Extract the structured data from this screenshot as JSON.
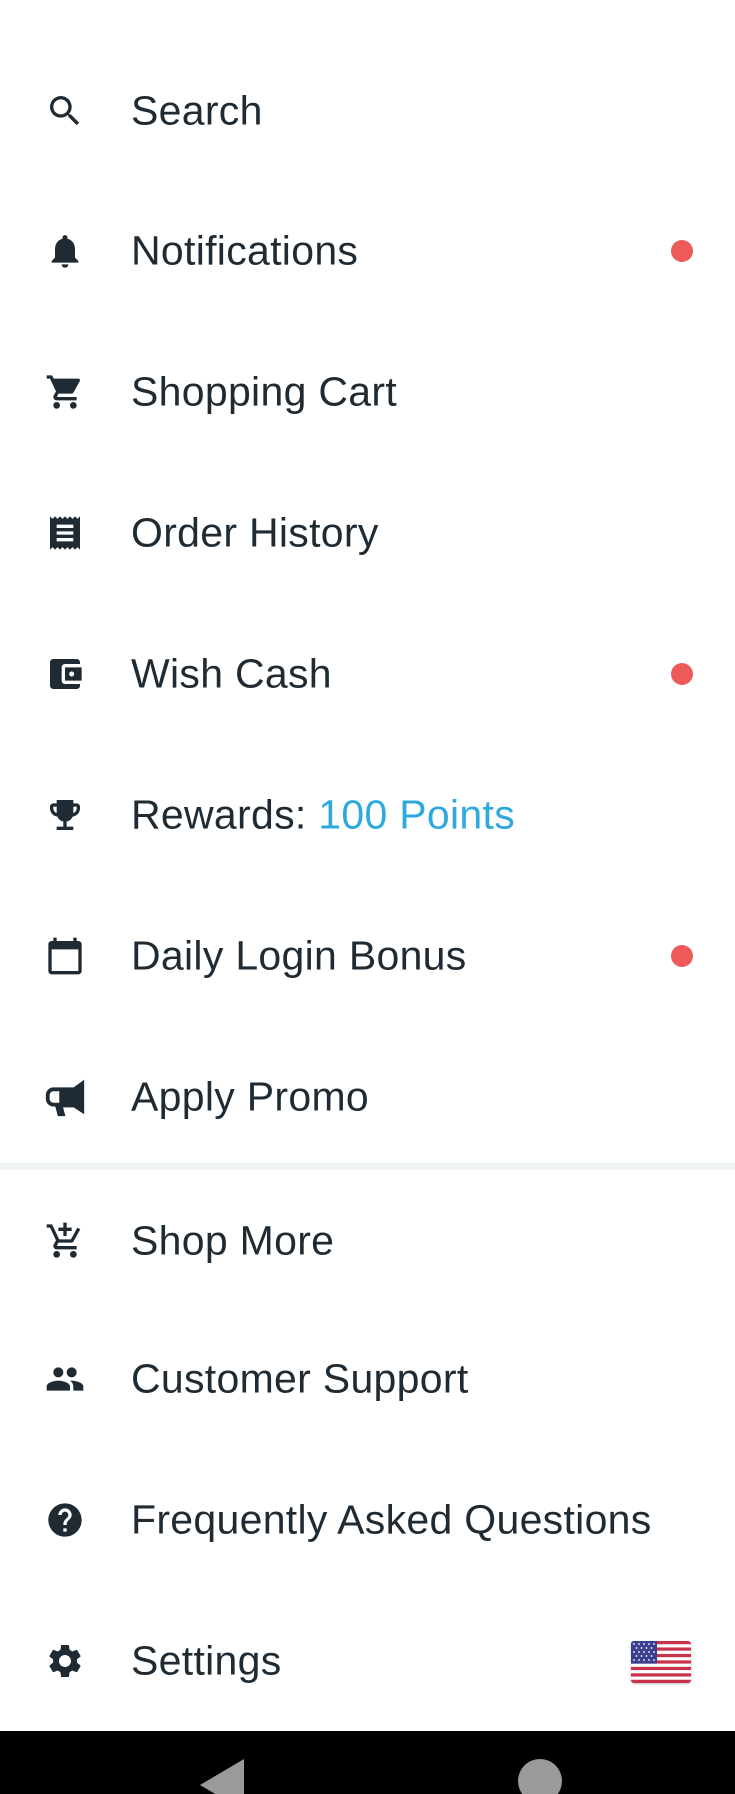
{
  "menu": {
    "search": {
      "label": "Search",
      "icon": "search-icon"
    },
    "notifications": {
      "label": "Notifications",
      "icon": "bell-icon",
      "badge_color": "#ec5a5a"
    },
    "shopping_cart": {
      "label": "Shopping Cart",
      "icon": "cart-icon"
    },
    "order_history": {
      "label": "Order History",
      "icon": "receipt-icon"
    },
    "wish_cash": {
      "label": "Wish Cash",
      "icon": "wallet-icon",
      "badge_color": "#ec5a5a"
    },
    "rewards": {
      "label": "Rewards:",
      "points": "100 Points",
      "icon": "trophy-icon",
      "accent_color": "#2fa9dd"
    },
    "daily_login_bonus": {
      "label": "Daily Login Bonus",
      "icon": "calendar-icon",
      "badge_color": "#ec5a5a"
    },
    "apply_promo": {
      "label": "Apply Promo",
      "icon": "megaphone-icon"
    },
    "shop_more": {
      "label": "Shop More",
      "icon": "add-to-cart-icon"
    },
    "customer_support": {
      "label": "Customer Support",
      "icon": "people-icon"
    },
    "faq": {
      "label": "Frequently Asked Questions",
      "icon": "help-circle-icon"
    },
    "settings": {
      "label": "Settings",
      "icon": "gear-icon",
      "flag": "us-flag-icon"
    }
  },
  "system_nav": {
    "back": "back-icon",
    "home": "home-icon"
  }
}
